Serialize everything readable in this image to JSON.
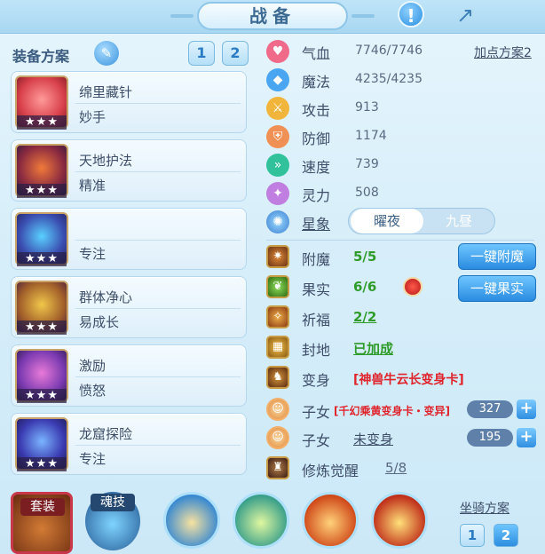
{
  "title": "战备",
  "icons": {
    "help": "help-icon",
    "share": "share-icon",
    "edit": "pencil-icon"
  },
  "left": {
    "title": "装备方案",
    "plans": [
      "1",
      "2"
    ],
    "cards": [
      {
        "name": "绵里藏针",
        "sub": "妙手",
        "stars": "★★★"
      },
      {
        "name": "天地护法",
        "sub": "精准",
        "stars": "★★★"
      },
      {
        "name": "",
        "sub": "专注",
        "stars": "★★★"
      },
      {
        "name": "群体净心",
        "sub": "易成长",
        "stars": "★★★"
      },
      {
        "name": "激励",
        "sub": "愤怒",
        "stars": "★★★"
      },
      {
        "name": "龙窟探险",
        "sub": "专注",
        "stars": "★★★"
      }
    ]
  },
  "stats": [
    {
      "label": "气血",
      "value": "7746/7746",
      "color": "#f06a8a"
    },
    {
      "label": "魔法",
      "value": "4235/4235",
      "color": "#4aa6f0"
    },
    {
      "label": "攻击",
      "value": "913",
      "color": "#f2b53b"
    },
    {
      "label": "防御",
      "value": "1174",
      "color": "#f19055"
    },
    {
      "label": "速度",
      "value": "739",
      "color": "#31c29c"
    },
    {
      "label": "灵力",
      "value": "508",
      "color": "#c07ee0"
    }
  ],
  "add_point_plan": "加点方案2",
  "star": {
    "label": "星象",
    "on": "曜夜",
    "off": "九昼"
  },
  "features": [
    {
      "label": "附魔",
      "value": "5/5"
    },
    {
      "label": "果实",
      "value": "6/6"
    },
    {
      "label": "祈福",
      "value": "2/2"
    },
    {
      "label": "封地",
      "value": "已加成"
    },
    {
      "label": "变身",
      "value": "[神兽牛云长变身卡]"
    },
    {
      "label": "子女",
      "value": "[千幻乘黄变身卡・变异]",
      "count": "327"
    },
    {
      "label": "子女",
      "value": "未变身",
      "count": "195"
    },
    {
      "label": "修炼觉醒",
      "value": "5/8"
    }
  ],
  "buttons": {
    "enchant": "一键附魔",
    "fruit": "一键果实"
  },
  "bottom": {
    "suit": "套装",
    "soul": "魂技",
    "mount_title": "坐骑方案",
    "mount_plans": [
      "1",
      "2"
    ]
  }
}
